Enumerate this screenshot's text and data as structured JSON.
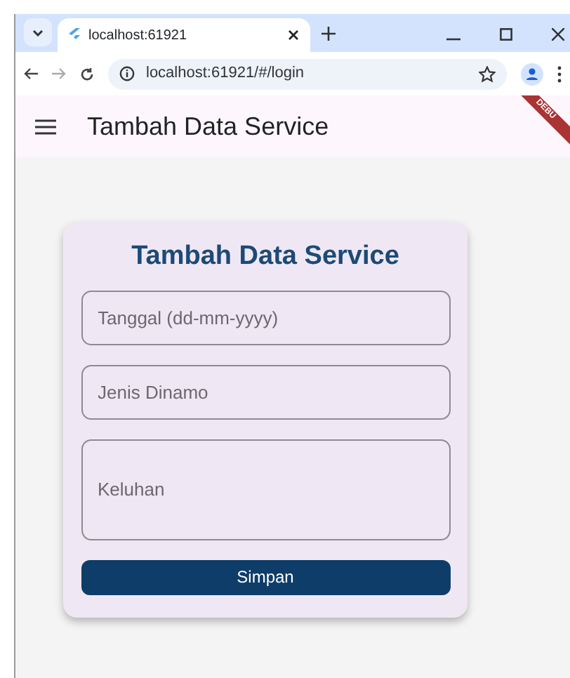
{
  "browser": {
    "tab_title": "localhost:61921",
    "url": "localhost:61921/#/login"
  },
  "app_bar": {
    "title": "Tambah Data Service",
    "debug_banner": "DEBU"
  },
  "form": {
    "title": "Tambah Data Service",
    "fields": [
      {
        "placeholder": "Tanggal (dd-mm-yyyy)",
        "kind": "line"
      },
      {
        "placeholder": "Jenis Dinamo",
        "kind": "line"
      },
      {
        "placeholder": "Keluhan",
        "kind": "area"
      }
    ],
    "button": "Simpan"
  }
}
